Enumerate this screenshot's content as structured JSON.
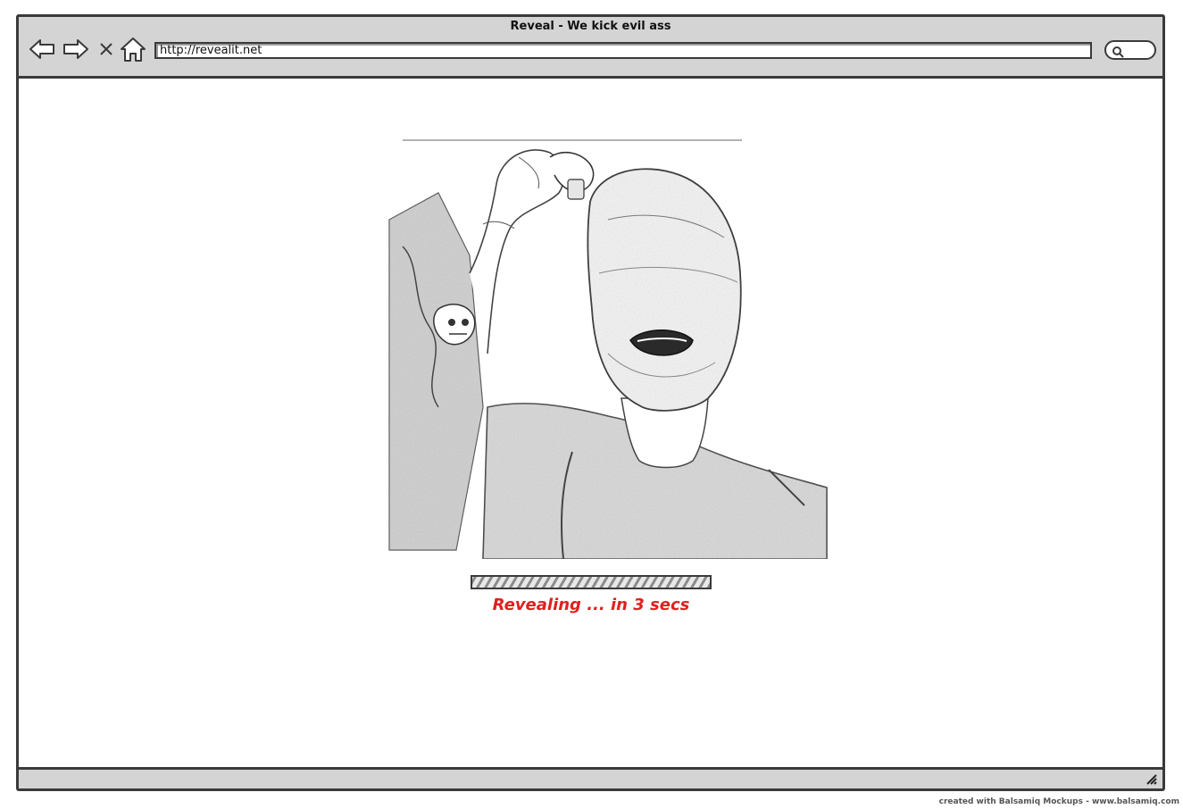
{
  "window": {
    "title": "Reveal - We kick evil ass",
    "address": "http://revealit.net"
  },
  "toolbar": {
    "back_icon": "back-arrow-icon",
    "forward_icon": "forward-arrow-icon",
    "stop_icon": "stop-x-icon",
    "home_icon": "home-icon",
    "search_icon": "search-icon"
  },
  "main": {
    "image_subject": "masked-person-sketch",
    "progress_fraction": 1.0,
    "status_text": "Revealing ... in 3 secs",
    "status_color": "#e02020"
  },
  "footer": {
    "credit": "created with Balsamiq Mockups - www.balsamiq.com"
  }
}
